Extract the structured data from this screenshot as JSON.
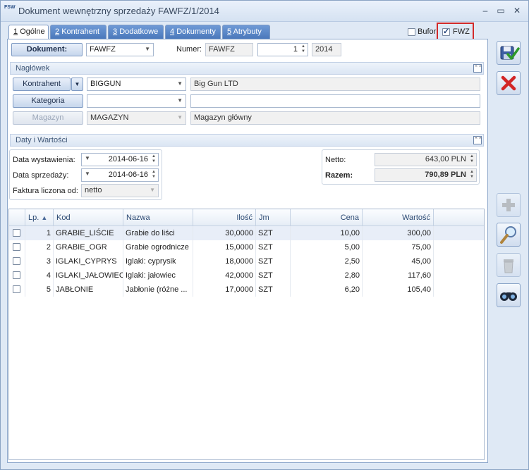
{
  "window": {
    "app_icon": "FSW",
    "title": "Dokument wewnętrzny sprzedaży FAWFZ/1/2014"
  },
  "tabs": [
    {
      "key": "1",
      "label": "Ogólne"
    },
    {
      "key": "2",
      "label": "Kontrahent"
    },
    {
      "key": "3",
      "label": "Dodatkowe"
    },
    {
      "key": "4",
      "label": "Dokumenty"
    },
    {
      "key": "5",
      "label": "Atrybuty"
    }
  ],
  "flags": {
    "bufor_label": "Bufor",
    "bufor_checked": false,
    "fwz_label": "FWZ",
    "fwz_checked": true
  },
  "doc": {
    "button": "Dokument:",
    "type_value": "FAWFZ",
    "numer_label": "Numer:",
    "numer_prefix": "FAWFZ",
    "numer_value": "1",
    "year": "2014"
  },
  "naglowek": {
    "title": "Nagłówek",
    "kontrahent_btn": "Kontrahent",
    "kontrahent_code": "BIGGUN",
    "kontrahent_name": "Big Gun LTD",
    "kategoria_btn": "Kategoria",
    "kategoria_value": "",
    "kategoria_desc": "",
    "magazyn_btn": "Magazyn",
    "magazyn_code": "MAGAZYN",
    "magazyn_name": "Magazyn główny"
  },
  "daty": {
    "title": "Daty i Wartości",
    "wystawienia_label": "Data wystawienia:",
    "wystawienia_value": "2014-06-16",
    "sprzedazy_label": "Data sprzedaży:",
    "sprzedazy_value": "2014-06-16",
    "faktura_label": "Faktura liczona od:",
    "faktura_value": "netto",
    "netto_label": "Netto:",
    "netto_value": "643,00 PLN",
    "razem_label": "Razem:",
    "razem_value": "790,89 PLN"
  },
  "table": {
    "columns": {
      "lp": "Lp.",
      "kod": "Kod",
      "nazwa": "Nazwa",
      "ilosc": "Ilość",
      "jm": "Jm",
      "cena": "Cena",
      "wartosc": "Wartość"
    },
    "sort_indicator": "▲",
    "rows": [
      {
        "lp": "1",
        "kod": "GRABIE_LIŚCIE",
        "nazwa": "Grabie do liści",
        "ilosc": "30,0000",
        "jm": "SZT",
        "cena": "10,00",
        "wartosc": "300,00"
      },
      {
        "lp": "2",
        "kod": "GRABIE_OGR",
        "nazwa": "Grabie ogrodnicze",
        "ilosc": "15,0000",
        "jm": "SZT",
        "cena": "5,00",
        "wartosc": "75,00"
      },
      {
        "lp": "3",
        "kod": "IGLAKI_CYPRYS",
        "nazwa": "Iglaki: cyprysik",
        "ilosc": "18,0000",
        "jm": "SZT",
        "cena": "2,50",
        "wartosc": "45,00"
      },
      {
        "lp": "4",
        "kod": "IGLAKI_JAŁOWIEC",
        "nazwa": "Iglaki: jałowiec",
        "ilosc": "42,0000",
        "jm": "SZT",
        "cena": "2,80",
        "wartosc": "117,60"
      },
      {
        "lp": "5",
        "kod": "JABŁONIE",
        "nazwa": "Jabłonie (różne ...",
        "ilosc": "17,0000",
        "jm": "SZT",
        "cena": "6,20",
        "wartosc": "105,40"
      }
    ]
  },
  "icons": {
    "save": "save-icon",
    "cancel": "cancel-icon",
    "add": "add-icon",
    "edit": "magnifier-icon",
    "delete": "trash-icon",
    "browse": "binoculars-icon"
  }
}
